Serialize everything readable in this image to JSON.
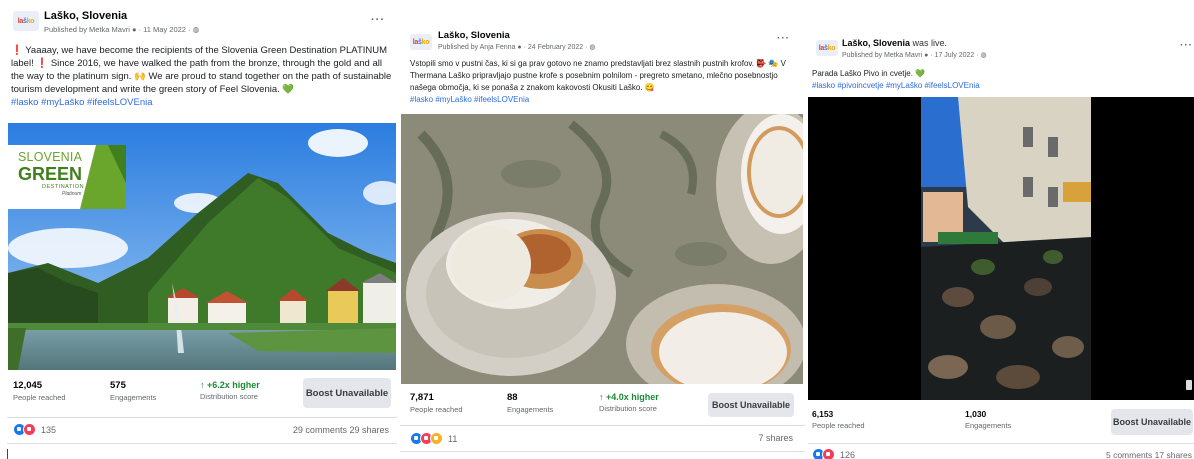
{
  "posts": [
    {
      "page_name": "Laško, Slovenia",
      "name_suffix": "",
      "published_by": "Published by Metka Mavri",
      "date": "11 May 2022",
      "text": "❗ Yaaaay, we have become the recipients of the Slovenia Green Destination PLATINUM label! ❗ Since 2016, we have walked the path from the bronze, through the gold and all the way to the platinum sign. 🙌 We are proud to stand together on the path of sustainable tourism development and write the green story of Feel Slovenia. 💚",
      "hashtags": "#lasko #myLaško #ifeelsLOVEnia",
      "image_badge": {
        "line1": "SLOVENIA",
        "line2": "GREEN",
        "line3": "DESTINATION",
        "line4": "Platinum"
      },
      "stats": [
        {
          "value": "12,045",
          "label": "People reached"
        },
        {
          "value": "575",
          "label": "Engagements"
        },
        {
          "value": "↑ +6.2x higher",
          "label": "Distribution score"
        }
      ],
      "boost_label": "Boost Unavailable",
      "reaction_count": "135",
      "comments": "29 comments",
      "shares": "29 shares"
    },
    {
      "page_name": "Laško, Slovenia",
      "name_suffix": "",
      "published_by": "Published by Anja Fenna",
      "date": "24 February 2022",
      "text": "Vstopili smo v pustni čas, ki si ga prav gotovo ne znamo predstavljati brez slastnih pustnih krofov. 👺 🎭 V Thermana Laško pripravljajo pustne krofe s posebnim polnilom - pregreto smetano, mlečno posebnostjo našega območja, ki se ponaša z znakom kakovosti Okusiti Laško. 😋",
      "hashtags": "#lasko #myLaško #ifeelsLOVEnia",
      "stats": [
        {
          "value": "7,871",
          "label": "People reached"
        },
        {
          "value": "88",
          "label": "Engagements"
        },
        {
          "value": "↑ +4.0x higher",
          "label": "Distribution score"
        }
      ],
      "boost_label": "Boost Unavailable",
      "reaction_count": "11",
      "shares": "7 shares"
    },
    {
      "page_name": "Laško, Slovenia",
      "name_suffix": " was live.",
      "published_by": "Published by Metka Mavri",
      "date": "17 July 2022",
      "text": "Parada Laško Pivo in cvetje. 💚",
      "hashtags": "#lasko #pivoincvetje #myLaško #ifeelsLOVEnia",
      "stats": [
        {
          "value": "6,153",
          "label": "People reached"
        },
        {
          "value": "1,030",
          "label": "Engagements"
        }
      ],
      "boost_label": "Boost Unavailable",
      "reaction_count": "126",
      "comments": "5 comments",
      "shares": "17 shares"
    }
  ],
  "logo_text": [
    "la",
    "š",
    "ko"
  ],
  "colors": {
    "accent_blue": "#2d6cdf",
    "green_score": "#1b8a35",
    "boost_bg": "#e4e6eb"
  }
}
